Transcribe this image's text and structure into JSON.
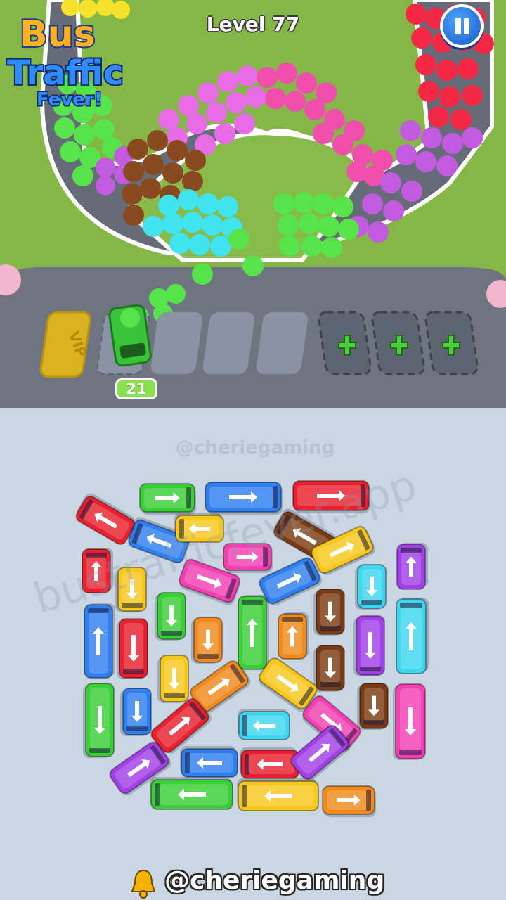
{
  "game": {
    "logo_line1": "Bus",
    "logo_line2": "Traffic",
    "logo_line3": "Fever!",
    "level_label": "Level 77",
    "pause_icon": "pause-icon"
  },
  "parking": {
    "vip_label": "VIP",
    "slot_passenger_count": "21",
    "slots": [
      "vip",
      "occupied-green",
      "empty",
      "empty",
      "empty",
      "locked-plus",
      "locked-plus",
      "locked-plus"
    ],
    "plus_icon": "plus-icon"
  },
  "watermarks": {
    "top": "@cheriegaming",
    "diagonal": "bustrafficfever.app"
  },
  "footer": {
    "bell_icon": "bell-icon",
    "handle": "@cheriegaming"
  },
  "colors": {
    "grass": "#82b545",
    "road": "#6f7580",
    "board_bg": "#cbd6e3",
    "pause_blue": "#1e6fe0",
    "count_green": "#8be04f"
  }
}
